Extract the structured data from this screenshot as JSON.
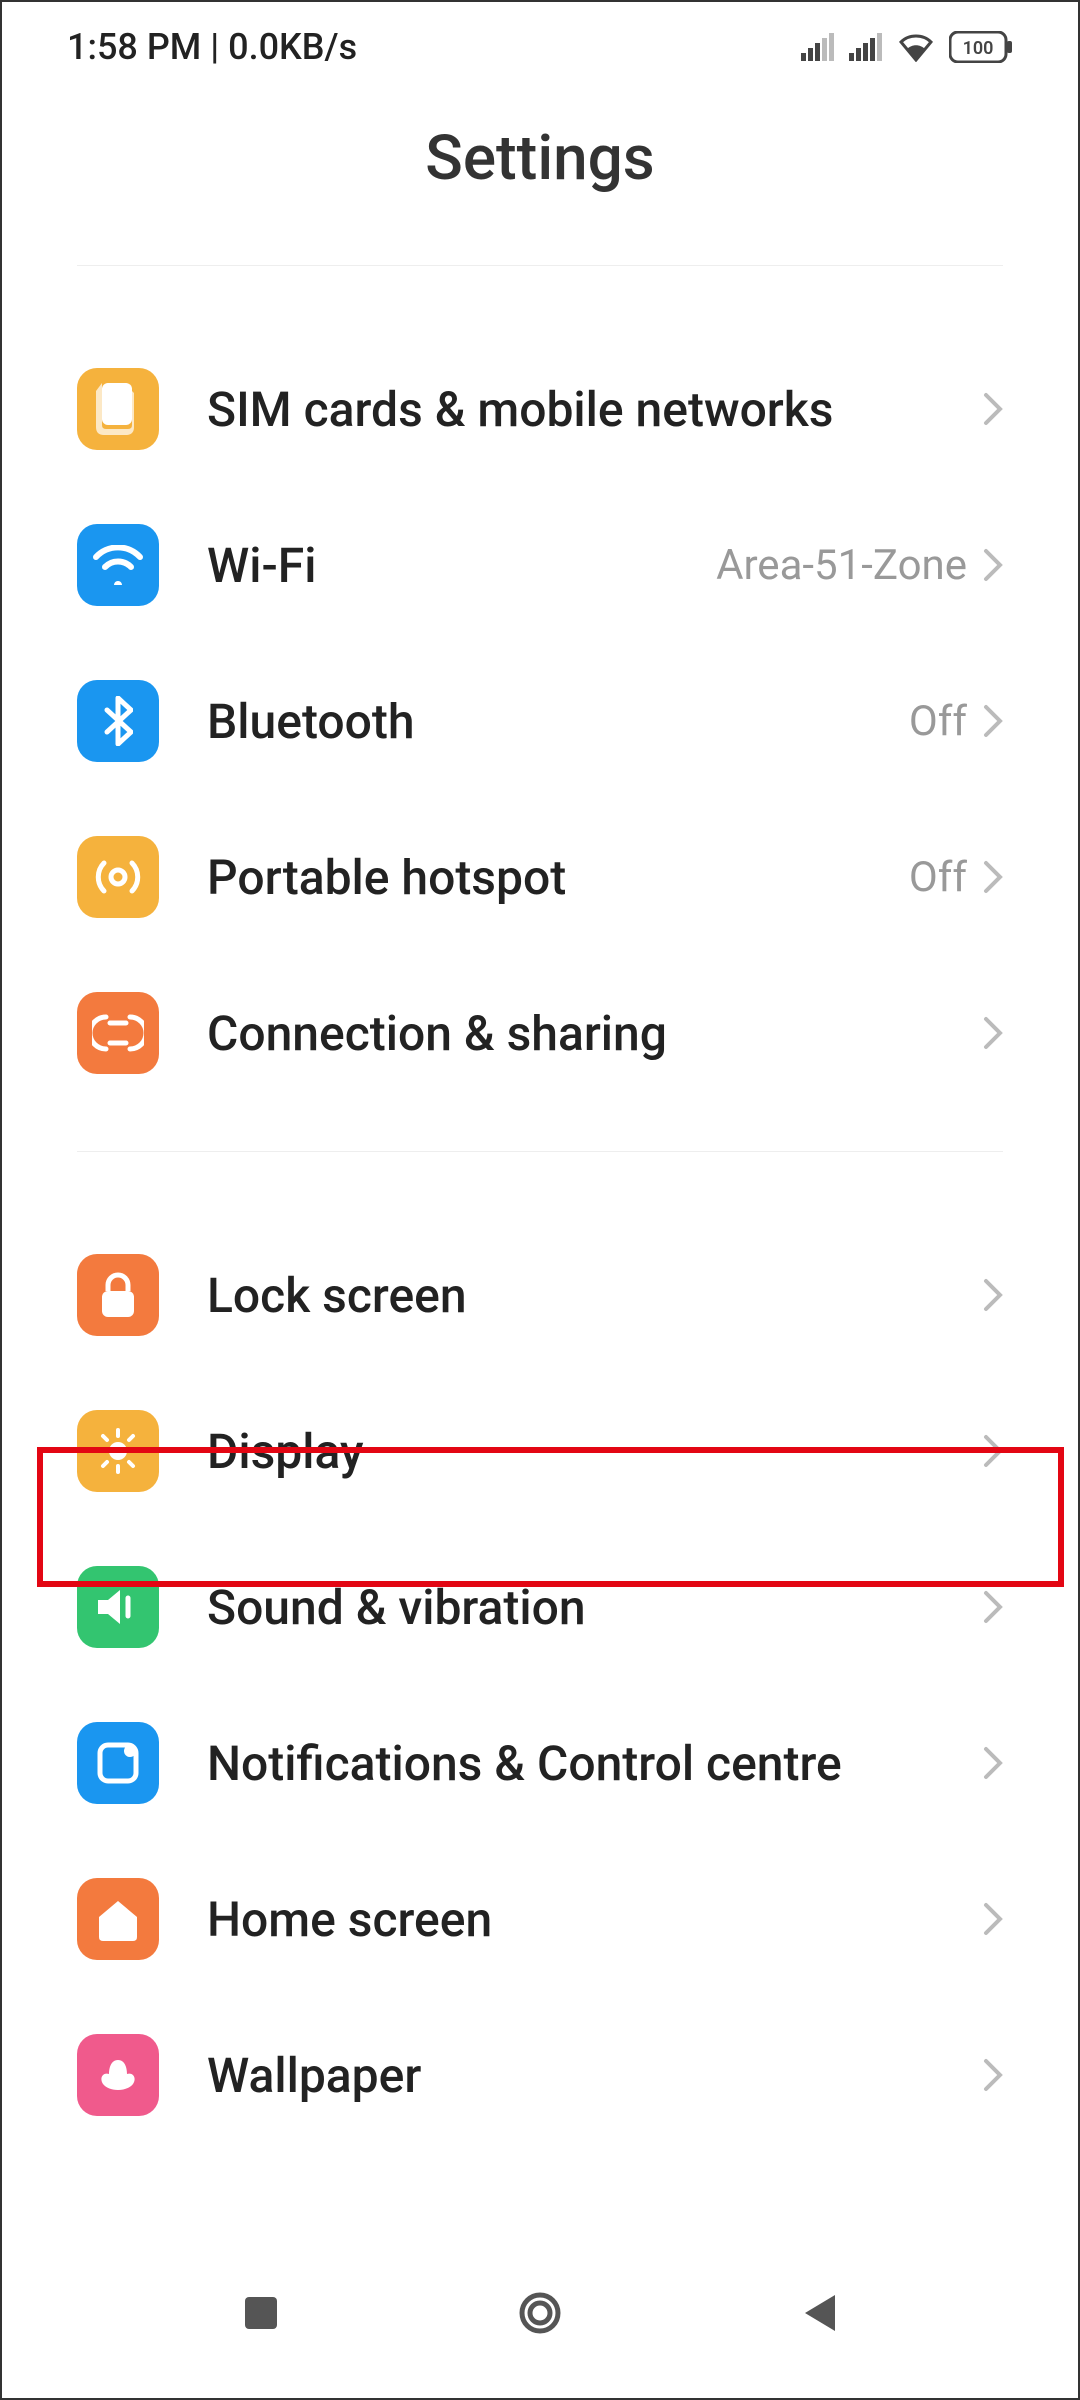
{
  "status_bar": {
    "time_net": "1:58 PM | 0.0KB/s",
    "battery": "100"
  },
  "header": {
    "title": "Settings"
  },
  "sections": [
    {
      "rows": [
        {
          "id": "sim",
          "label": "SIM cards & mobile networks",
          "value": ""
        },
        {
          "id": "wifi",
          "label": "Wi-Fi",
          "value": "Area-51-Zone"
        },
        {
          "id": "bluetooth",
          "label": "Bluetooth",
          "value": "Off"
        },
        {
          "id": "hotspot",
          "label": "Portable hotspot",
          "value": "Off"
        },
        {
          "id": "connection",
          "label": "Connection & sharing",
          "value": ""
        }
      ]
    },
    {
      "rows": [
        {
          "id": "lock",
          "label": "Lock screen",
          "value": ""
        },
        {
          "id": "display",
          "label": "Display",
          "value": ""
        },
        {
          "id": "sound",
          "label": "Sound & vibration",
          "value": ""
        },
        {
          "id": "notifications",
          "label": "Notifications & Control centre",
          "value": ""
        },
        {
          "id": "homescreen",
          "label": "Home screen",
          "value": ""
        },
        {
          "id": "wallpaper",
          "label": "Wallpaper",
          "value": ""
        }
      ]
    }
  ]
}
